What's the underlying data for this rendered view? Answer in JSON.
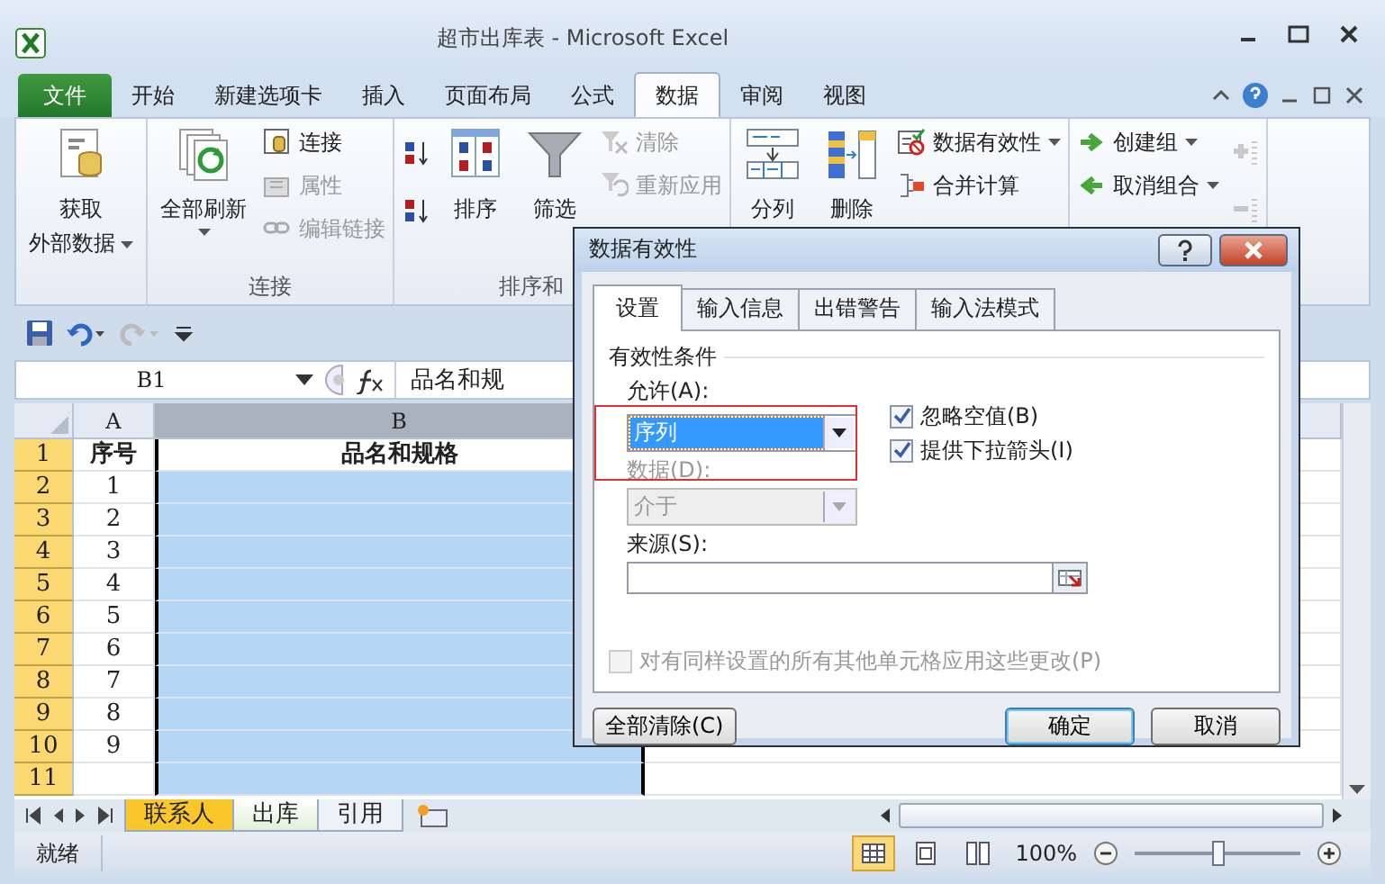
{
  "window": {
    "title": "超市出库表 - Microsoft Excel"
  },
  "ribbon_tabs": [
    {
      "label": "文件",
      "kind": "file",
      "selected": false
    },
    {
      "label": "开始",
      "kind": "tab",
      "selected": false
    },
    {
      "label": "新建选项卡",
      "kind": "tab",
      "selected": false
    },
    {
      "label": "插入",
      "kind": "tab",
      "selected": false
    },
    {
      "label": "页面布局",
      "kind": "tab",
      "selected": false
    },
    {
      "label": "公式",
      "kind": "tab",
      "selected": false
    },
    {
      "label": "数据",
      "kind": "tab",
      "selected": true
    },
    {
      "label": "审阅",
      "kind": "tab",
      "selected": false
    },
    {
      "label": "视图",
      "kind": "tab",
      "selected": false
    }
  ],
  "ribbon_groups": [
    {
      "commands": [
        {
          "kind": "large",
          "lines": [
            "获取",
            "外部数据"
          ],
          "dropdown": true,
          "disabled": false
        }
      ]
    },
    {
      "label": "连接",
      "commands": [
        {
          "kind": "large",
          "lines": [
            "全部刷新"
          ],
          "dropdown": true,
          "disabled": false
        },
        {
          "kind": "small",
          "label": "连接",
          "disabled": false
        },
        {
          "kind": "small",
          "label": "属性",
          "disabled": true
        },
        {
          "kind": "small",
          "label": "编辑链接",
          "disabled": true
        }
      ]
    },
    {
      "label": "排序和",
      "commands": [
        {
          "kind": "icon",
          "disabled": false
        },
        {
          "kind": "icon",
          "disabled": false
        },
        {
          "kind": "large",
          "lines": [
            "排序"
          ],
          "disabled": false
        },
        {
          "kind": "large",
          "lines": [
            "筛选"
          ],
          "disabled": false
        },
        {
          "kind": "small",
          "label": "清除",
          "disabled": true
        },
        {
          "kind": "small",
          "label": "重新应用",
          "disabled": true
        }
      ]
    },
    {
      "commands": [
        {
          "kind": "large",
          "lines": [
            "分列"
          ],
          "disabled": false
        },
        {
          "kind": "large",
          "lines": [
            "删除"
          ],
          "disabled": false
        },
        {
          "kind": "small",
          "label": "数据有效性",
          "dropdown": true,
          "disabled": false
        },
        {
          "kind": "small",
          "label": "合并计算",
          "disabled": false
        }
      ]
    },
    {
      "commands": [
        {
          "kind": "small",
          "label": "创建组",
          "dropdown": true,
          "disabled": false
        },
        {
          "kind": "small",
          "label": "取消组合",
          "dropdown": true,
          "disabled": false
        },
        {
          "kind": "icon",
          "disabled": true
        },
        {
          "kind": "icon",
          "disabled": true
        }
      ]
    }
  ],
  "formula_bar": {
    "name_box": "B1",
    "formula": "品名和规"
  },
  "grid": {
    "columns": [
      {
        "label": "A",
        "selected": false
      },
      {
        "label": "B",
        "selected": true
      }
    ],
    "rows": [
      {
        "number": "1",
        "selected": true,
        "cells": [
          {
            "text": "序号",
            "selected": false
          },
          {
            "text": "品名和规格",
            "selected": false
          }
        ]
      },
      {
        "number": "2",
        "selected": true,
        "cells": [
          {
            "text": "1",
            "selected": false
          },
          {
            "selected": true
          }
        ]
      },
      {
        "number": "3",
        "selected": true,
        "cells": [
          {
            "text": "2",
            "selected": false
          },
          {
            "selected": true
          }
        ]
      },
      {
        "number": "4",
        "selected": true,
        "cells": [
          {
            "text": "3",
            "selected": false
          },
          {
            "selected": true
          }
        ]
      },
      {
        "number": "5",
        "selected": true,
        "cells": [
          {
            "text": "4",
            "selected": false
          },
          {
            "selected": true
          }
        ]
      },
      {
        "number": "6",
        "selected": true,
        "cells": [
          {
            "text": "5",
            "selected": false
          },
          {
            "selected": true
          }
        ]
      },
      {
        "number": "7",
        "selected": true,
        "cells": [
          {
            "text": "6",
            "selected": false
          },
          {
            "selected": true
          }
        ]
      },
      {
        "number": "8",
        "selected": true,
        "cells": [
          {
            "text": "7",
            "selected": false
          },
          {
            "selected": true
          }
        ]
      },
      {
        "number": "9",
        "selected": true,
        "cells": [
          {
            "text": "8",
            "selected": false
          },
          {
            "selected": true
          }
        ]
      },
      {
        "number": "10",
        "selected": true,
        "cells": [
          {
            "text": "9",
            "selected": false
          },
          {
            "selected": true
          }
        ]
      },
      {
        "number": "11",
        "selected": true,
        "cells": [
          {
            "selected": false
          },
          {
            "selected": true
          }
        ]
      }
    ]
  },
  "sheet_tabs": [
    {
      "label": "联系人",
      "selected": false,
      "color": "#f9c72a"
    },
    {
      "label": "出库",
      "selected": true
    },
    {
      "label": "引用",
      "selected": false
    }
  ],
  "status_bar": {
    "text": "就绪",
    "views": [
      {
        "kind": "normal",
        "selected": true
      },
      {
        "kind": "layout",
        "selected": false
      },
      {
        "kind": "pagebreak",
        "selected": false
      }
    ],
    "zoom": "100%",
    "zoom_slider": {
      "level": 0.5
    }
  },
  "dialog": {
    "title": "数据有效性",
    "tabs": [
      {
        "label": "设置",
        "selected": true
      },
      {
        "label": "输入信息",
        "selected": false
      },
      {
        "label": "出错警告",
        "selected": false
      },
      {
        "label": "输入法模式",
        "selected": false
      }
    ],
    "section": "有效性条件",
    "allow": {
      "label": "允许(A):",
      "value": "序列"
    },
    "checkboxes": [
      {
        "label": "忽略空值(B)",
        "checked": true
      },
      {
        "label": "提供下拉箭头(I)",
        "checked": true
      }
    ],
    "data": {
      "label": "数据(D):",
      "value": "介于",
      "disabled": true
    },
    "source": {
      "label": "来源(S):"
    },
    "apply_all": {
      "label": "对有同样设置的所有其他单元格应用这些更改(P)",
      "checked": false,
      "disabled": true
    },
    "buttons": [
      {
        "label": "全部清除(C)",
        "kind": "left",
        "default": false
      },
      {
        "label": "确定",
        "kind": "right",
        "default": true
      },
      {
        "label": "取消",
        "kind": "right",
        "default": false
      }
    ]
  }
}
